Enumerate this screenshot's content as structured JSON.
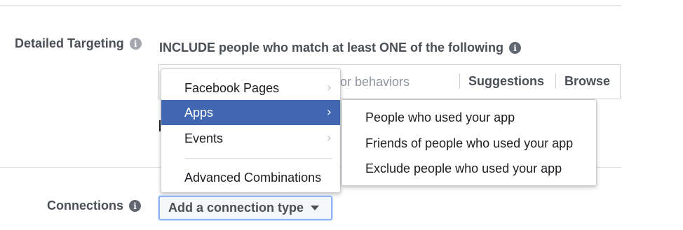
{
  "detailed_targeting": {
    "label": "Detailed Targeting",
    "include_text": "INCLUDE people who match at least ONE of the following",
    "search_placeholder": "or behaviors",
    "suggestions_label": "Suggestions",
    "browse_label": "Browse"
  },
  "menu": {
    "items": [
      {
        "label": "Facebook Pages",
        "has_submenu": true,
        "active": false
      },
      {
        "label": "Apps",
        "has_submenu": true,
        "active": true
      },
      {
        "label": "Events",
        "has_submenu": true,
        "active": false
      },
      {
        "label": "Advanced Combinations",
        "has_submenu": false,
        "active": false
      }
    ]
  },
  "submenu": {
    "items": [
      {
        "label": "People who used your app"
      },
      {
        "label": "Friends of people who used your app"
      },
      {
        "label": "Exclude people who used your app"
      }
    ]
  },
  "connections": {
    "label": "Connections",
    "button_label": "Add a connection type"
  },
  "colors": {
    "active_menu_bg": "#4267b2",
    "label_text": "#4b4f56",
    "focus_border": "#90b4f5"
  }
}
